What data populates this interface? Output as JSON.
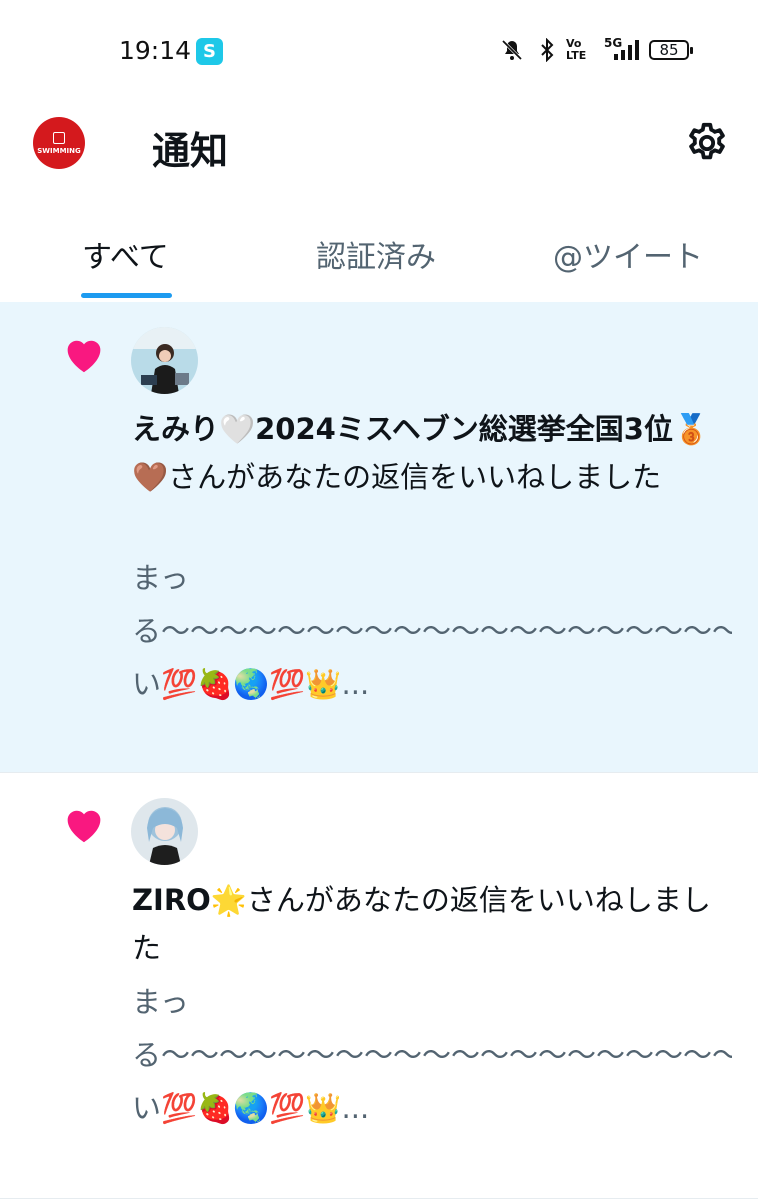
{
  "status_bar": {
    "time": "19:14",
    "app_badge_glyph": "S",
    "network": "5G",
    "volte": "Vo LTE",
    "battery": "85"
  },
  "header": {
    "title": "通知",
    "avatar_text": "SWIMMING",
    "settings_icon": "gear-icon"
  },
  "tabs": [
    {
      "label": "すべて",
      "active": true
    },
    {
      "label": "認証済み",
      "active": false
    },
    {
      "label": "@ツイート",
      "active": false
    }
  ],
  "notifications": [
    {
      "icon": "heart-icon",
      "user_name": "えみり🤍2024ミスヘブン総選挙全国3位🥉🤎",
      "action": "さんがあなたの返信をいいねしました",
      "preview": "まっる〜〜〜〜〜〜〜〜〜〜〜〜〜〜〜〜〜〜〜〜〜〜〜〜〜〜〜〜〜〜〜〜〜〜〜〜〜〜〜〜〜〜〜〜〜〜〜〜〜〜〜〜〜〜〜〜〜〜〜〜〜〜〜〜〜〜〜〜〜〜〜〜〜〜〜〜〜〜〜い💯🍓🌏💯👑...",
      "unread": true
    },
    {
      "icon": "heart-icon",
      "user_name": "ZIRO🌟",
      "action": "さんがあなたの返信をいいねしました",
      "preview": "まっる〜〜〜〜〜〜〜〜〜〜〜〜〜〜〜〜〜〜〜〜〜〜〜〜〜〜〜〜〜〜〜〜〜〜〜〜〜〜〜〜〜〜〜〜〜〜〜〜〜〜〜〜〜〜〜〜〜〜〜〜〜〜〜〜〜〜〜〜〜〜〜〜〜〜〜〜〜〜〜い💯🍓🌏💯👑...",
      "unread": false
    }
  ],
  "colors": {
    "accent": "#1d9bf0",
    "heart": "#f91880",
    "unread_bg": "#e9f6fd",
    "secondary_text": "#536471"
  }
}
